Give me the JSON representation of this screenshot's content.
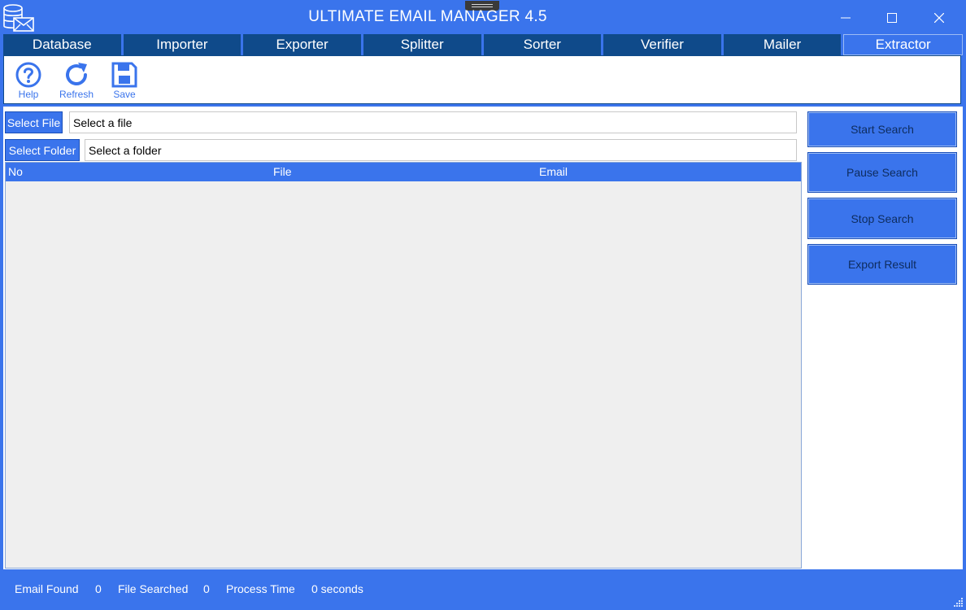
{
  "window": {
    "title": "ULTIMATE EMAIL MANAGER 4.5"
  },
  "tabs": [
    {
      "label": "Database"
    },
    {
      "label": "Importer"
    },
    {
      "label": "Exporter"
    },
    {
      "label": "Splitter"
    },
    {
      "label": "Sorter"
    },
    {
      "label": "Verifier"
    },
    {
      "label": "Mailer"
    },
    {
      "label": "Extractor",
      "active": true
    }
  ],
  "toolbar": {
    "help": "Help",
    "refresh": "Refresh",
    "save": "Save"
  },
  "file": {
    "button": "Select File",
    "value": "Select a file"
  },
  "folder": {
    "button": "Select Folder",
    "value": "Select a folder"
  },
  "table": {
    "columns": [
      "No",
      "File",
      "Email"
    ],
    "rows": []
  },
  "actions": {
    "start": "Start Search",
    "pause": "Pause Search",
    "stop": "Stop Search",
    "export": "Export Result"
  },
  "status": {
    "email_found_label": "Email Found",
    "email_found": "0",
    "file_searched_label": "File Searched",
    "file_searched": "0",
    "process_time_label": "Process Time",
    "process_time": "0 seconds"
  },
  "colors": {
    "accent": "#3a74ec",
    "tab_bg": "#0f4a8a",
    "grid_bg": "#efefef"
  },
  "icons": [
    "app-database-mail-icon",
    "help-icon",
    "refresh-icon",
    "save-icon",
    "minimize-icon",
    "maximize-icon",
    "close-icon",
    "resize-grip-icon"
  ]
}
